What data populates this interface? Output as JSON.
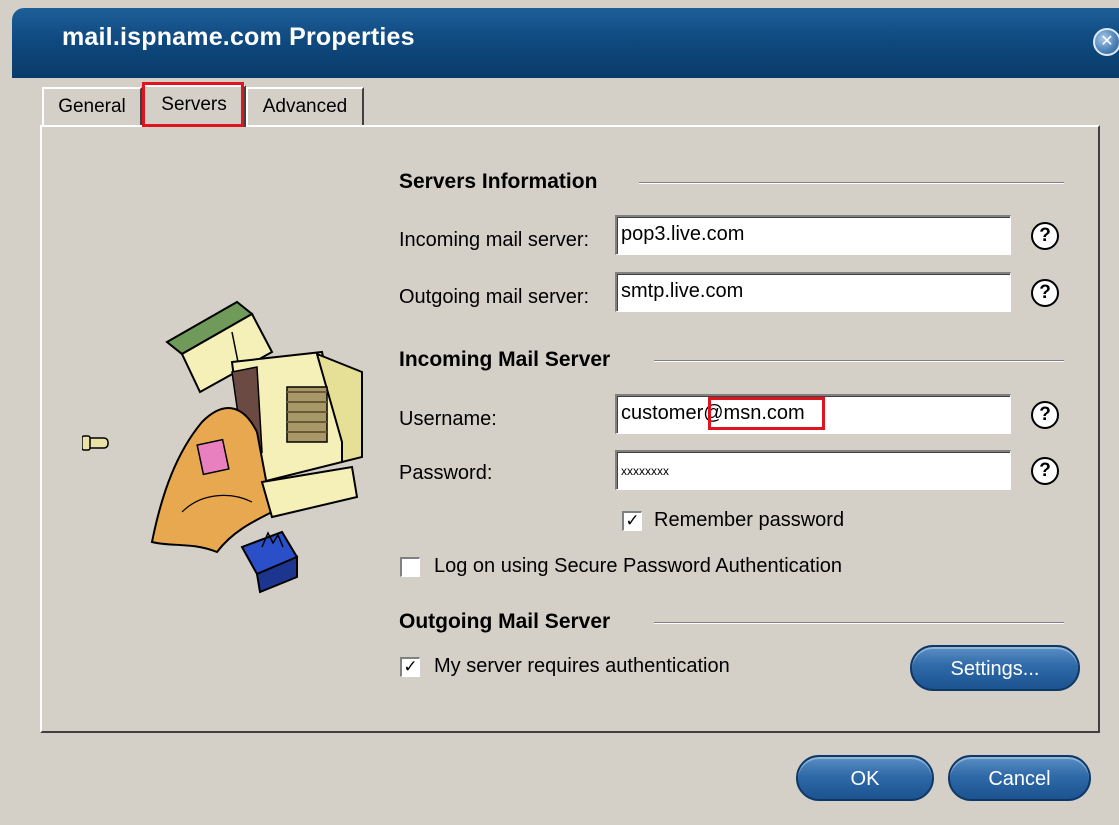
{
  "window": {
    "title": "mail.ispname.com Properties",
    "close_glyph": "✕"
  },
  "tabs": [
    {
      "label": "General"
    },
    {
      "label": "Servers",
      "selected": true
    },
    {
      "label": "Advanced"
    }
  ],
  "servers_info": {
    "heading": "Servers Information",
    "incoming_label": "Incoming mail server:",
    "incoming_value": "pop3.live.com",
    "outgoing_label": "Outgoing mail server:",
    "outgoing_value": "smtp.live.com"
  },
  "incoming_mail": {
    "heading": "Incoming Mail Server",
    "username_label": "Username:",
    "username_value_prefix": "customer",
    "username_value_domain": "@msn.com",
    "password_label": "Password:",
    "password_value": "xxxxxxxx",
    "remember_label": "Remember password",
    "remember_checked": true,
    "spa_label": "Log on using Secure Password Authentication",
    "spa_checked": false
  },
  "outgoing_mail": {
    "heading": "Outgoing Mail Server",
    "auth_label": "My server requires authentication",
    "auth_checked": true,
    "settings_label": "Settings..."
  },
  "help_glyph": "?",
  "check_glyph": "✓",
  "buttons": {
    "ok": "OK",
    "cancel": "Cancel"
  },
  "colors": {
    "titlebar": "#0f4a80",
    "highlight": "#e0141e",
    "button": "#2f6aa8"
  }
}
